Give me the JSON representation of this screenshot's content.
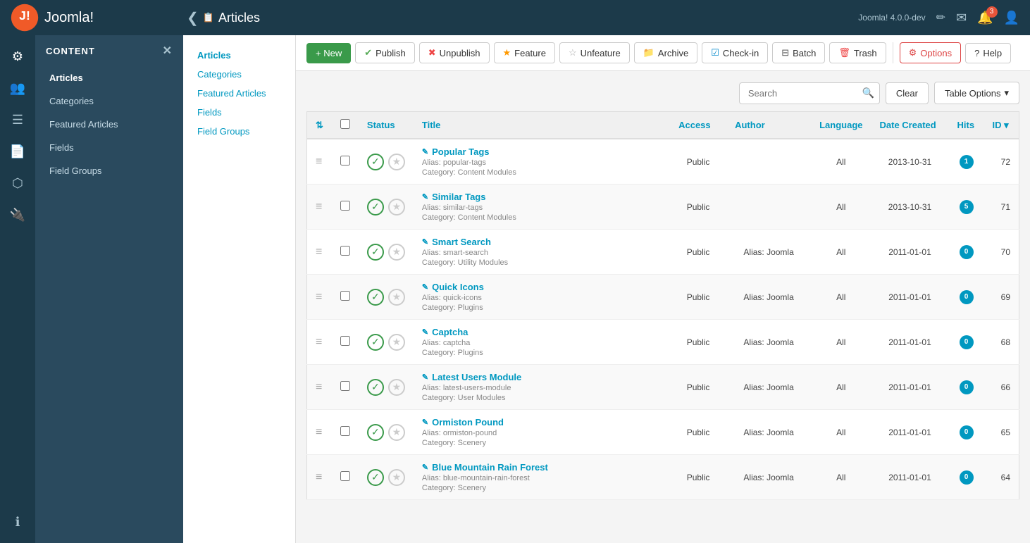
{
  "topbar": {
    "back_label": "‹",
    "page_icon": "📋",
    "page_title": "Articles",
    "version": "Joomla! 4.0.0-dev",
    "notification_count": "3"
  },
  "toolbar": {
    "new_label": "+ New",
    "publish_label": "Publish",
    "unpublish_label": "Unpublish",
    "feature_label": "Feature",
    "unfeature_label": "Unfeature",
    "archive_label": "Archive",
    "checkin_label": "Check-in",
    "batch_label": "Batch",
    "trash_label": "Trash",
    "options_label": "Options",
    "help_label": "Help"
  },
  "sidebar": {
    "header": "CONTENT",
    "items": [
      {
        "label": "Articles",
        "active": true
      },
      {
        "label": "Categories"
      },
      {
        "label": "Featured Articles"
      },
      {
        "label": "Fields"
      },
      {
        "label": "Field Groups"
      }
    ]
  },
  "submenu": {
    "items": [
      {
        "label": "Articles",
        "active": true
      },
      {
        "label": "Categories"
      },
      {
        "label": "Featured Articles"
      },
      {
        "label": "Fields"
      },
      {
        "label": "Field Groups"
      }
    ]
  },
  "search": {
    "placeholder": "Search",
    "clear_label": "Clear",
    "table_options_label": "Table Options"
  },
  "table": {
    "columns": {
      "status": "Status",
      "title": "Title",
      "access": "Access",
      "author": "Author",
      "language": "Language",
      "date_created": "Date Created",
      "hits": "Hits",
      "id": "ID"
    },
    "rows": [
      {
        "id": 72,
        "title": "Popular Tags",
        "title_icon": "✎",
        "alias": "popular-tags",
        "category": "Content Modules",
        "access": "Public",
        "author": "",
        "language": "All",
        "date_created": "2013-10-31",
        "hits": "1",
        "hits_class": "one",
        "status": "published"
      },
      {
        "id": 71,
        "title": "Similar Tags",
        "title_icon": "✎",
        "alias": "similar-tags",
        "category": "Content Modules",
        "access": "Public",
        "author": "",
        "language": "All",
        "date_created": "2013-10-31",
        "hits": "5",
        "hits_class": "five",
        "status": "published"
      },
      {
        "id": 70,
        "title": "Smart Search",
        "title_icon": "✎",
        "alias": "smart-search",
        "category": "Utility Modules",
        "access": "Public",
        "author": "Alias: Joomla",
        "language": "All",
        "date_created": "2011-01-01",
        "hits": "0",
        "hits_class": "zero",
        "status": "published"
      },
      {
        "id": 69,
        "title": "Quick Icons",
        "title_icon": "✎",
        "alias": "quick-icons",
        "category": "Plugins",
        "access": "Public",
        "author": "Alias: Joomla",
        "language": "All",
        "date_created": "2011-01-01",
        "hits": "0",
        "hits_class": "zero",
        "status": "published"
      },
      {
        "id": 68,
        "title": "Captcha",
        "title_icon": "✎",
        "alias": "captcha",
        "category": "Plugins",
        "access": "Public",
        "author": "Alias: Joomla",
        "language": "All",
        "date_created": "2011-01-01",
        "hits": "0",
        "hits_class": "zero",
        "status": "published"
      },
      {
        "id": 66,
        "title": "Latest Users Module",
        "title_icon": "✎",
        "alias": "latest-users-module",
        "category": "User Modules",
        "access": "Public",
        "author": "Alias: Joomla",
        "language": "All",
        "date_created": "2011-01-01",
        "hits": "0",
        "hits_class": "zero",
        "status": "published"
      },
      {
        "id": 65,
        "title": "Ormiston Pound",
        "title_icon": "✎",
        "alias": "ormiston-pound",
        "category": "Scenery",
        "access": "Public",
        "author": "Alias: Joomla",
        "language": "All",
        "date_created": "2011-01-01",
        "hits": "0",
        "hits_class": "zero",
        "status": "published"
      },
      {
        "id": 64,
        "title": "Blue Mountain Rain Forest",
        "title_icon": "✎",
        "alias": "blue-mountain-rain-forest",
        "category": "Scenery",
        "access": "Public",
        "author": "Alias: Joomla",
        "language": "All",
        "date_created": "2011-01-01",
        "hits": "0",
        "hits_class": "zero",
        "status": "published"
      }
    ]
  },
  "icons": {
    "drag": "≡",
    "check": "✓",
    "star": "★",
    "sort_up_down": "⇅",
    "chevron_down": "▾",
    "search": "🔍",
    "publish": "✔",
    "unpublish": "✖",
    "feature": "★",
    "unfeature": "☆",
    "archive": "📁",
    "checkin": "☑",
    "batch": "📋",
    "trash": "🗑",
    "options": "⚙",
    "help": "?",
    "back": "❮",
    "articles_icon": "📄",
    "notification": "🔔",
    "mail": "✉",
    "user": "👤",
    "edit_icon": "✏",
    "menu_icon": "≡",
    "gear_icon": "⚙",
    "users_icon": "👥",
    "list_icon": "☰",
    "module_icon": "⬡",
    "plugin_icon": "🔌",
    "info_icon": "ℹ"
  }
}
